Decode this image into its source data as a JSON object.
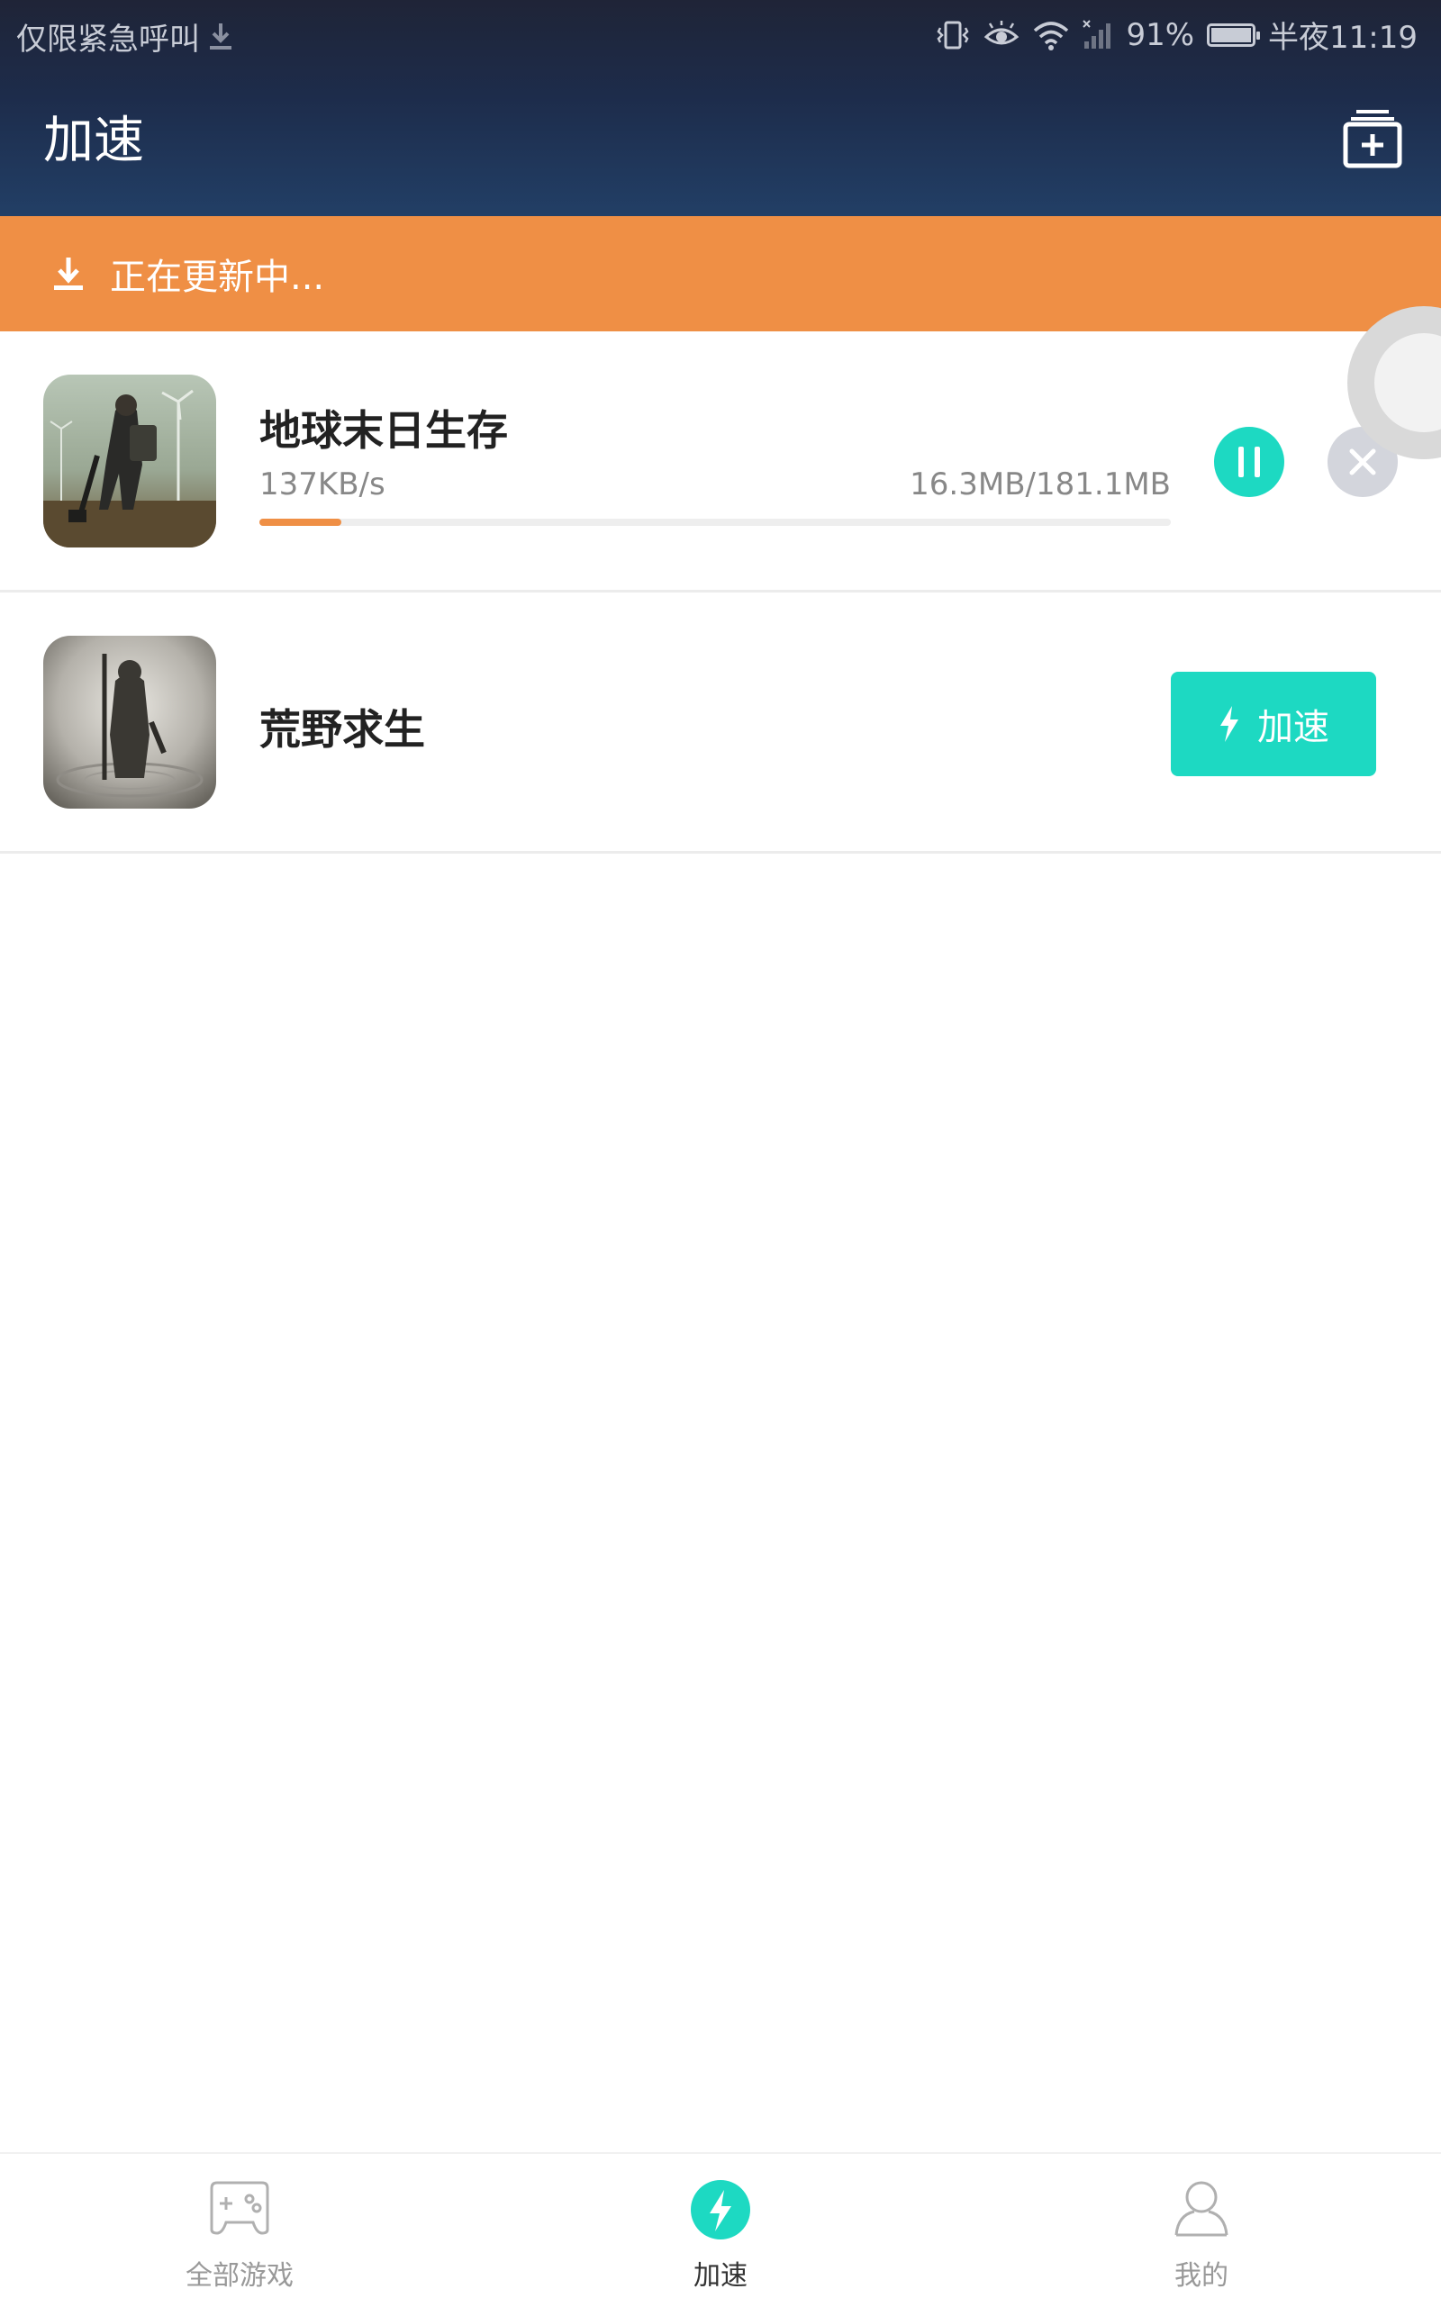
{
  "status_bar": {
    "carrier_text": "仅限紧急呼叫",
    "battery_percent": "91%",
    "time": "半夜11:19",
    "icons": [
      "download-icon",
      "vibrate-icon",
      "eye-comfort-icon",
      "wifi-icon",
      "signal-icon",
      "battery-icon"
    ]
  },
  "header": {
    "title": "加速",
    "action_icon": "add-library-icon"
  },
  "banner": {
    "text": "正在更新中...",
    "icon": "download-icon",
    "color": "#ef8f45"
  },
  "games": [
    {
      "name": "地球末日生存",
      "speed": "137KB/s",
      "size": "16.3MB/181.1MB",
      "progress_percent": 9,
      "state": "downloading",
      "actions": [
        "pause-icon",
        "close-icon"
      ]
    },
    {
      "name": "荒野求生",
      "state": "ready",
      "button_label": "加速",
      "button_icon": "lightning-icon"
    }
  ],
  "bottom_nav": {
    "items": [
      {
        "label": "全部游戏",
        "icon": "gamepad-icon",
        "active": false
      },
      {
        "label": "加速",
        "icon": "lightning-icon",
        "active": true
      },
      {
        "label": "我的",
        "icon": "user-icon",
        "active": false
      }
    ]
  },
  "colors": {
    "accent": "#1dd9c2",
    "banner": "#ef8f45",
    "header_top": "#1f2437",
    "header_bottom": "#223f66"
  }
}
